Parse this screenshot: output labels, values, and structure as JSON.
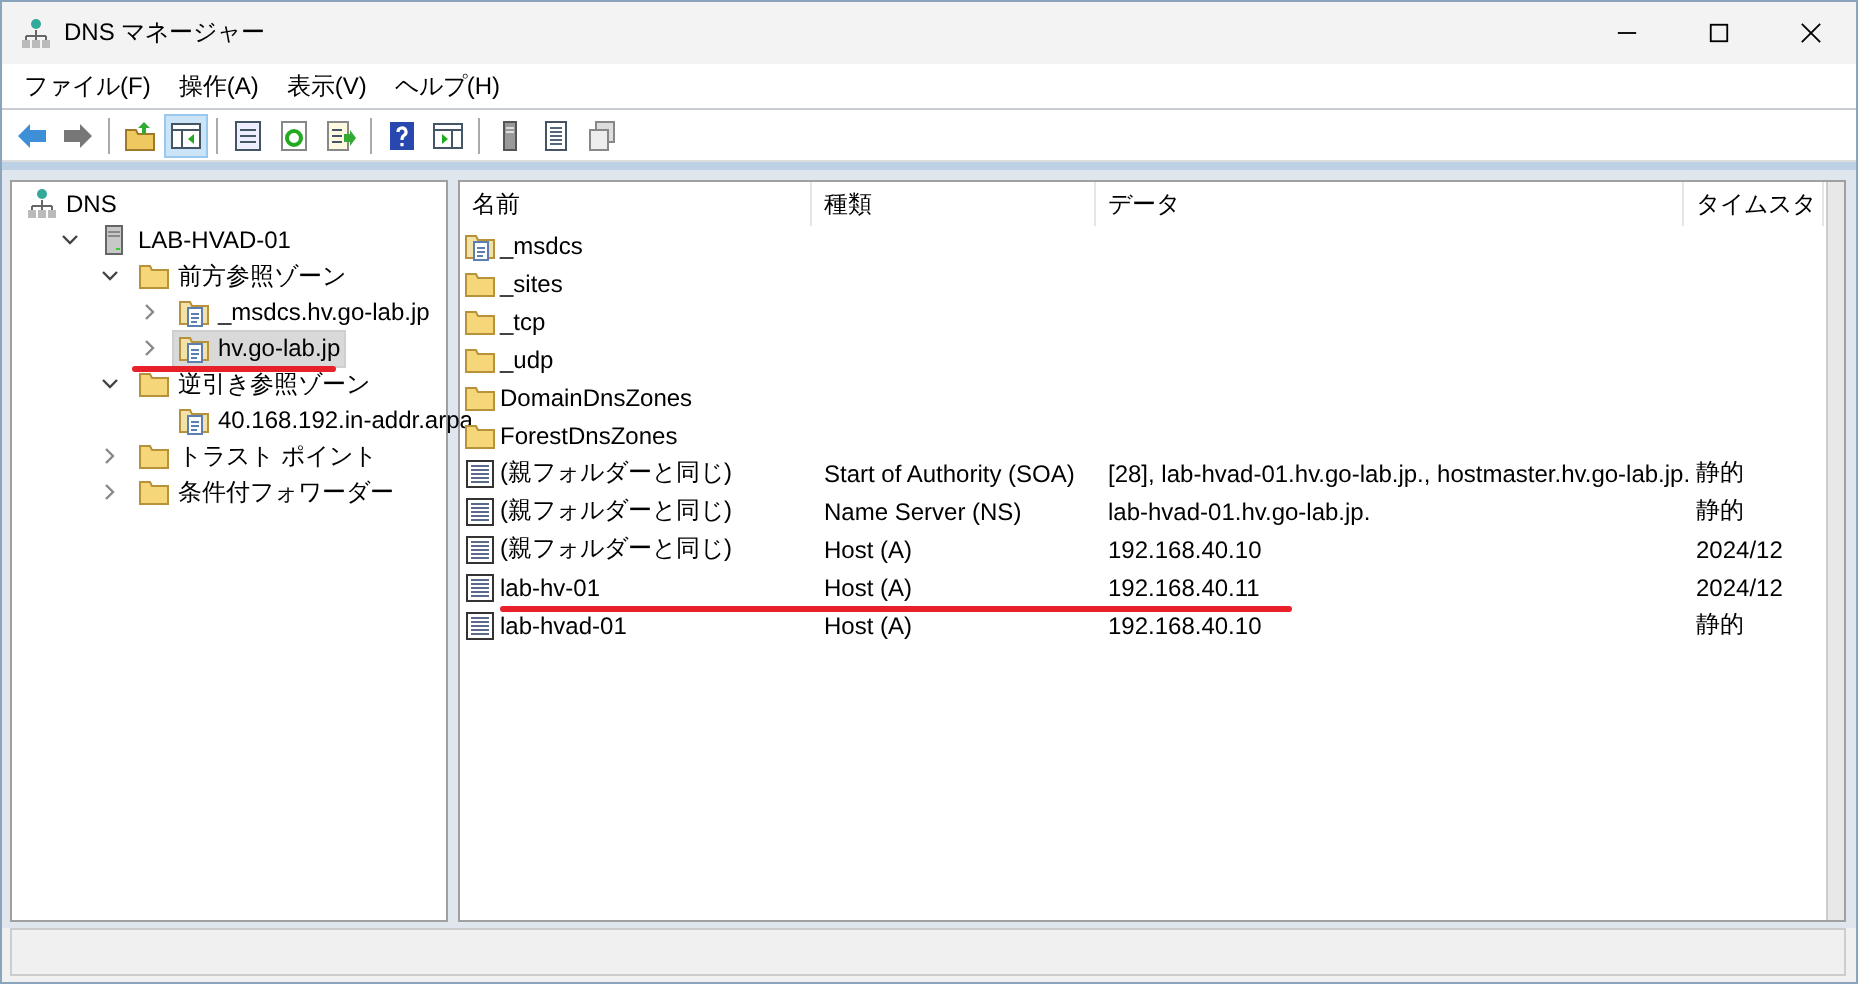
{
  "window": {
    "title": "DNS マネージャー"
  },
  "menu": [
    "ファイル(F)",
    "操作(A)",
    "表示(V)",
    "ヘルプ(H)"
  ],
  "toolbar": [
    {
      "kind": "back",
      "selected": false
    },
    {
      "kind": "forward",
      "selected": false
    },
    {
      "kind": "sep"
    },
    {
      "kind": "up",
      "selected": false
    },
    {
      "kind": "pane",
      "selected": true
    },
    {
      "kind": "sep"
    },
    {
      "kind": "props",
      "selected": false
    },
    {
      "kind": "refresh",
      "selected": false
    },
    {
      "kind": "export",
      "selected": false
    },
    {
      "kind": "sep"
    },
    {
      "kind": "help",
      "selected": false
    },
    {
      "kind": "action",
      "selected": false
    },
    {
      "kind": "sep"
    },
    {
      "kind": "server",
      "selected": false
    },
    {
      "kind": "list",
      "selected": false
    },
    {
      "kind": "copy",
      "selected": false
    }
  ],
  "tree": [
    {
      "label": "DNS",
      "kind": "dns",
      "selected": false,
      "marked": false,
      "children": [
        {
          "label": "LAB-HVAD-01",
          "kind": "server",
          "expanded": true,
          "selected": false,
          "marked": false,
          "children": [
            {
              "label": "前方参照ゾーン",
              "kind": "folder",
              "expanded": true,
              "selected": false,
              "marked": false,
              "children": [
                {
                  "label": "_msdcs.hv.go-lab.jp",
                  "kind": "zone",
                  "expanded": false,
                  "selected": false,
                  "marked": false
                },
                {
                  "label": "hv.go-lab.jp",
                  "kind": "zone",
                  "expanded": false,
                  "selected": true,
                  "marked": true
                }
              ]
            },
            {
              "label": "逆引き参照ゾーン",
              "kind": "folder",
              "expanded": true,
              "selected": false,
              "marked": false,
              "children": [
                {
                  "label": "40.168.192.in-addr.arpa",
                  "kind": "zone",
                  "selected": false,
                  "marked": false
                }
              ]
            },
            {
              "label": "トラスト ポイント",
              "kind": "folder",
              "expanded": false,
              "selected": false,
              "marked": false
            },
            {
              "label": "条件付フォワーダー",
              "kind": "folder",
              "expanded": false,
              "selected": false,
              "marked": false
            }
          ]
        }
      ]
    }
  ],
  "table": {
    "columns": [
      "名前",
      "種類",
      "データ",
      "タイムスタ"
    ],
    "rows": [
      {
        "kind": "zone",
        "name": "_msdcs",
        "marked": false
      },
      {
        "kind": "folder",
        "name": "_sites",
        "marked": false
      },
      {
        "kind": "folder",
        "name": "_tcp",
        "marked": false
      },
      {
        "kind": "folder",
        "name": "_udp",
        "marked": false
      },
      {
        "kind": "folder",
        "name": "DomainDnsZones",
        "marked": false
      },
      {
        "kind": "folder",
        "name": "ForestDnsZones",
        "marked": false
      },
      {
        "kind": "record",
        "name": "(親フォルダーと同じ)",
        "type": "Start of Authority (SOA)",
        "data": "[28], lab-hvad-01.hv.go-lab.jp., hostmaster.hv.go-lab.jp.",
        "timestamp": "静的",
        "marked": false
      },
      {
        "kind": "record",
        "name": "(親フォルダーと同じ)",
        "type": "Name Server (NS)",
        "data": "lab-hvad-01.hv.go-lab.jp.",
        "timestamp": "静的",
        "marked": false
      },
      {
        "kind": "record",
        "name": "(親フォルダーと同じ)",
        "type": "Host (A)",
        "data": "192.168.40.10",
        "timestamp": "2024/12",
        "marked": false
      },
      {
        "kind": "record",
        "name": "lab-hv-01",
        "type": "Host (A)",
        "data": "192.168.40.11",
        "timestamp": "2024/12",
        "marked": true
      },
      {
        "kind": "record",
        "name": "lab-hvad-01",
        "type": "Host (A)",
        "data": "192.168.40.10",
        "timestamp": "静的",
        "marked": false
      }
    ]
  }
}
